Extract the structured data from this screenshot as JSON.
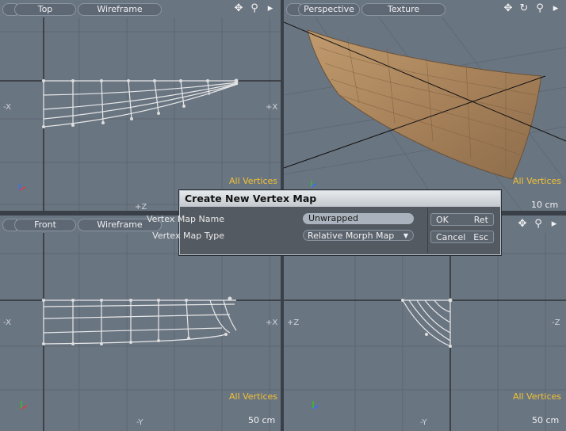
{
  "viewports": {
    "top_left": {
      "view": "Top",
      "shading": "Wireframe",
      "selection": "All Vertices",
      "left_axis": "-X",
      "right_axis": "+X",
      "bottom_axis": "+Z"
    },
    "top_right": {
      "view": "Perspective",
      "shading": "Texture",
      "selection": "All Vertices",
      "scale": "10 cm"
    },
    "bottom_left": {
      "view": "Front",
      "shading": "Wireframe",
      "selection": "All Vertices",
      "left_axis": "-X",
      "right_axis": "+X",
      "bottom_axis": "-Y",
      "scale": "50 cm"
    },
    "bottom_right": {
      "selection": "All Vertices",
      "left_axis": "+Z",
      "right_axis": "-Z",
      "bottom_axis": "-Y",
      "scale": "50 cm"
    }
  },
  "dialog": {
    "title": "Create New Vertex Map",
    "name_label": "Vertex Map Name",
    "name_value": "Unwrapped",
    "type_label": "Vertex Map Type",
    "type_value": "Relative Morph Map",
    "ok_label": "OK",
    "ok_shortcut": "Ret",
    "cancel_label": "Cancel",
    "cancel_shortcut": "Esc"
  },
  "icons": {
    "pan": "pan-icon",
    "rotate": "rotate-icon",
    "zoom": "zoom-icon",
    "menu": "menu-arrow-icon"
  },
  "colors": {
    "viewport_bg": "#6a7582",
    "selection_label": "#f2c232",
    "hull_texture": "#a88660"
  }
}
